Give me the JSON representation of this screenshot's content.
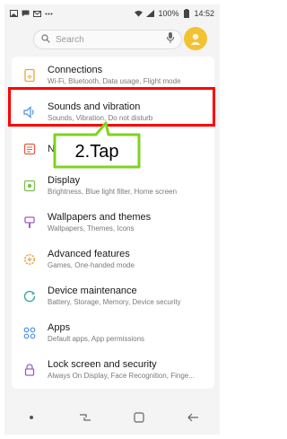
{
  "status_bar": {
    "battery_percent": "100%",
    "time": "14:52",
    "left_icons": [
      "image-icon",
      "message-icon",
      "mail-icon",
      "more-dots-icon"
    ],
    "right_icons": [
      "wifi-icon",
      "signal-icon",
      "battery-icon"
    ]
  },
  "search": {
    "placeholder": "Search"
  },
  "settings": {
    "items": [
      {
        "title": "Connections",
        "subtitle": "Wi-Fi, Bluetooth, Data usage, Flight mode",
        "icon": "connections-icon"
      },
      {
        "title": "Sounds and vibration",
        "subtitle": "Sounds, Vibration, Do not disturb",
        "icon": "speaker-icon"
      },
      {
        "title": "Notifications",
        "subtitle": "",
        "icon": "notifications-icon"
      },
      {
        "title": "Display",
        "subtitle": "Brightness, Blue light filter, Home screen",
        "icon": "display-icon"
      },
      {
        "title": "Wallpapers and themes",
        "subtitle": "Wallpapers, Themes, Icons",
        "icon": "paintbrush-icon"
      },
      {
        "title": "Advanced features",
        "subtitle": "Games, One-handed mode",
        "icon": "gear-plus-icon"
      },
      {
        "title": "Device maintenance",
        "subtitle": "Battery, Storage, Memory, Device security",
        "icon": "maintenance-icon"
      },
      {
        "title": "Apps",
        "subtitle": "Default apps, App permissions",
        "icon": "apps-grid-icon"
      },
      {
        "title": "Lock screen and security",
        "subtitle": "Always On Display, Face Recognition, Finge...",
        "icon": "lock-icon"
      }
    ]
  },
  "annotation": {
    "label": "2.Tap"
  },
  "colors": {
    "highlight": "#ff0000",
    "callout_fill": "#ffffff",
    "callout_border": "#7ed321",
    "icon_accent": "#e8a33d"
  },
  "nav_bar": {
    "icons": [
      "dot-icon",
      "recents-icon",
      "home-icon",
      "back-icon"
    ]
  }
}
